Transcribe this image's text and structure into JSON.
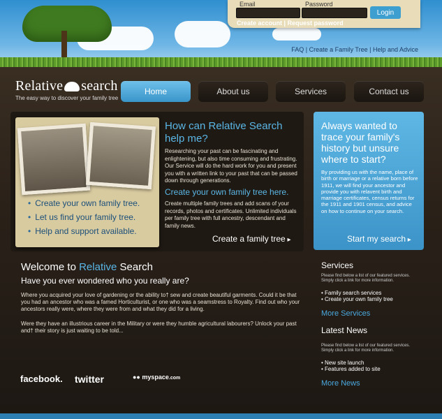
{
  "login": {
    "email_label": "Email",
    "password_label": "Password",
    "button_label": "Login",
    "create_account": "Create account",
    "separator": "|",
    "request_password": "Request password"
  },
  "top_links": [
    "FAQ",
    "Create a Family Tree",
    "Help and Advice"
  ],
  "logo": {
    "name_left": "Relative",
    "name_right": "search",
    "tagline": "The easy way to discover your family tree"
  },
  "nav": [
    "Home",
    "About us",
    "Services",
    "Contact us"
  ],
  "feature": {
    "bullets": [
      "Create your own family tree.",
      "Let us find your family tree.",
      "Help and support available."
    ],
    "title": "How can Relative Search help me?",
    "text1": "Researching your past can be fascinating and enlightening, but also time consuming and frustrating. Our Service will do the hard work for you and present you with a written link to your past that can be passed down through generations.",
    "subtitle": "Create your own family tree here.",
    "text2": "Create multiple family trees and add scans of your records, photos and certificates. Unlimited individuals per family tree with full ancestry, descendant and family news.",
    "cta": "Create a family tree"
  },
  "promo": {
    "heading": "Always wanted to trace your family's history but unsure where to start?",
    "text": "By providing us with the name, place of birth or marriage or a relative born before 1911, we will find your ancestor and provide you with relavent birth and marriage certificates, census returns for the 1911 and 1901 census, and advice on how to continue on your search.",
    "cta": "Start my search"
  },
  "welcome": {
    "title_prefix": "Welcome to",
    "title_highlight": "Relative",
    "title_suffix": "Search",
    "subtitle": "Have you ever wondered who you really are?",
    "para1": "Where you acquired your love of gardening or the ability to† sew and create beautiful garments. Could it be that you had an ancestor who was a famed Horticulturist, or one who was a seamstress to Royalty. Find out who your ancestors really were, where they were from and what they did for a living.",
    "para2": "Were they have an illustrious career in the Military or were they humble agricultural labourers? Unlock your past and† their story is just waiting to be told..."
  },
  "services": {
    "heading": "Services",
    "intro": "Please find below a list of our featured services. Simply click a link for more information.",
    "items": [
      "Family search services",
      "Create your own family tree"
    ],
    "more": "More Services"
  },
  "news": {
    "heading": "Latest News",
    "intro": "Please find below a list of our featured services. Simply click a link for more information.",
    "items": [
      "New site launch",
      "Features added to site"
    ],
    "more": "More News"
  },
  "social": [
    "facebook.",
    "twitter",
    "myspace",
    ".com"
  ]
}
